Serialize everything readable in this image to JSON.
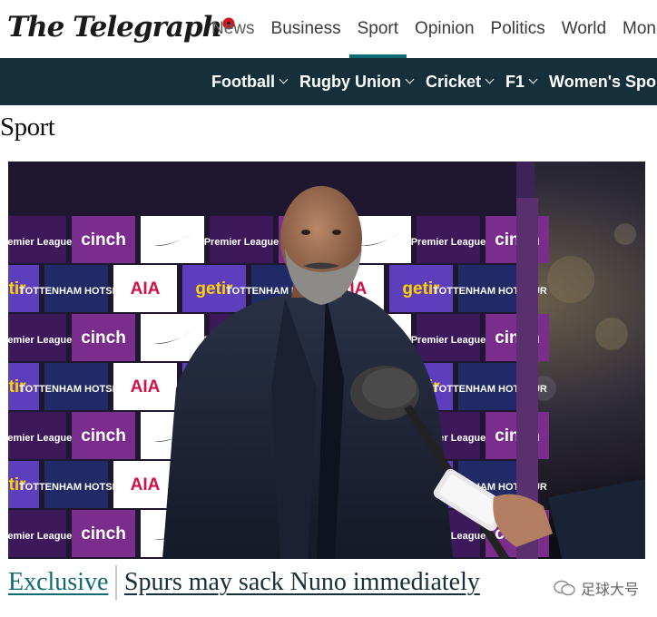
{
  "brand": {
    "name": "The Telegraph"
  },
  "top_nav": {
    "items": [
      "News",
      "Business",
      "Sport",
      "Opinion",
      "Politics",
      "World",
      "Money"
    ],
    "active": "Sport"
  },
  "sub_nav": {
    "items": [
      "Football",
      "Rugby Union",
      "Cricket",
      "F1",
      "Women's Spo"
    ]
  },
  "section": {
    "title": "Sport"
  },
  "hero": {
    "board_text": [
      "Premier League",
      "cinch",
      "getir",
      "AIA",
      "TOTTENHAM HOTSPUR"
    ]
  },
  "headline": {
    "tag": "Exclusive",
    "title": "Spurs may sack Nuno immediately"
  },
  "watermark": {
    "text": "足球大号"
  },
  "colors": {
    "accent": "#0f6a73",
    "subnav_bg": "#15303a",
    "premier_purple": "#3d195b",
    "getir_purple": "#5d3ebc",
    "aia_red": "#d31145"
  }
}
